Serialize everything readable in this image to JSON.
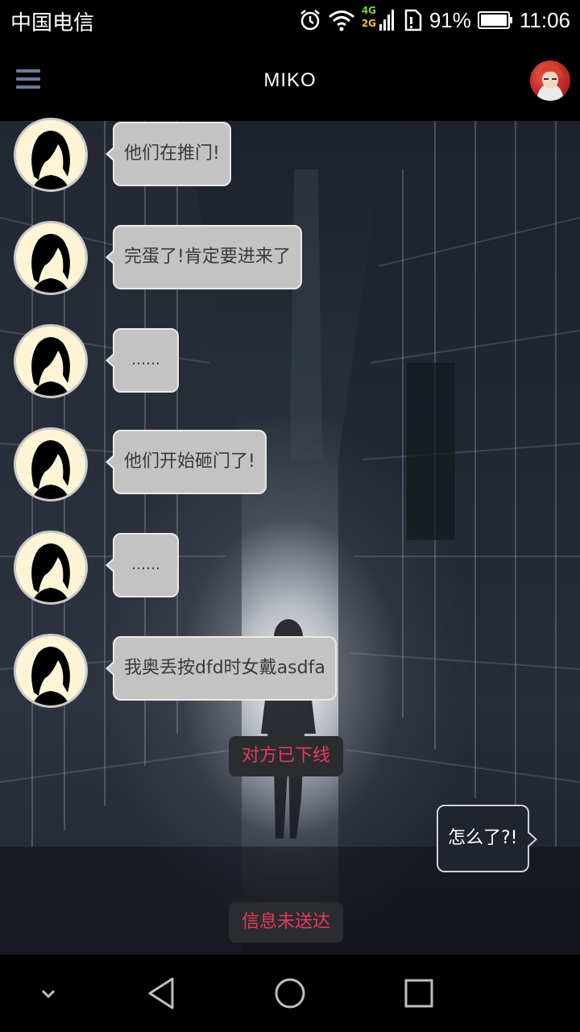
{
  "status_bar": {
    "carrier": "中国电信",
    "network_badge_top": "4G",
    "network_badge_bottom": "2G",
    "battery_percent": "91%",
    "time": "11:06"
  },
  "header": {
    "title": "MIKO"
  },
  "messages_received": [
    {
      "text": "他们在推门!"
    },
    {
      "text": "完蛋了!肯定要进来了"
    },
    {
      "text": "……"
    },
    {
      "text": "他们开始砸门了!"
    },
    {
      "text": "……"
    },
    {
      "text": "我奥丢按dfd时女戴asdfa"
    }
  ],
  "system_notes": {
    "offline": "对方已下线",
    "not_delivered": "信息未送达"
  },
  "message_sent": {
    "text": "怎么了?!"
  },
  "icons": {
    "menu": "hamburger-menu-icon",
    "alarm": "alarm-clock-icon",
    "wifi": "wifi-icon",
    "signal": "signal-icon",
    "sim": "sim-card-icon",
    "battery": "battery-icon",
    "nav_down": "chevron-down-icon",
    "nav_back": "back-triangle-icon",
    "nav_home": "home-circle-icon",
    "nav_recents": "recents-square-icon"
  },
  "colors": {
    "system_note_text": "#e8395d",
    "received_bubble": "#c3c3c3",
    "sent_bubble": "#20242c",
    "menu_icon": "#6f7a99"
  }
}
